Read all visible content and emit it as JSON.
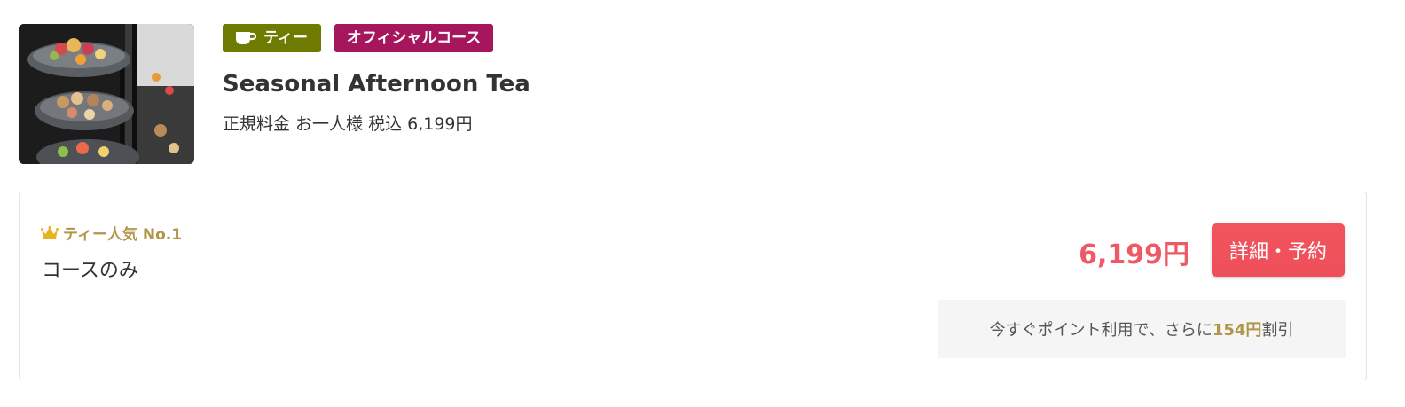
{
  "course": {
    "image_alt": "afternoon-tea-stand-photo",
    "tags": {
      "tea_label": "ティー",
      "tea_icon": "cup-icon",
      "official_label": "オフィシャルコース"
    },
    "title": "Seasonal Afternoon Tea",
    "regular_price": "正規料金 お一人様 税込 6,199円"
  },
  "plan": {
    "badge_icon": "crown-icon",
    "badge_label": "ティー人気 No.1",
    "name": "コースのみ",
    "price": "6,199円",
    "reserve_label": "詳細・予約",
    "point_prefix": "今すぐポイント利用で、さらに ",
    "point_amount": "154円",
    "point_suffix": "割引"
  },
  "colors": {
    "tea_tag": "#6e7a00",
    "official_tag": "#a6165d",
    "price": "#ef5865",
    "button": "#f2545d",
    "gold": "#b0954a"
  }
}
